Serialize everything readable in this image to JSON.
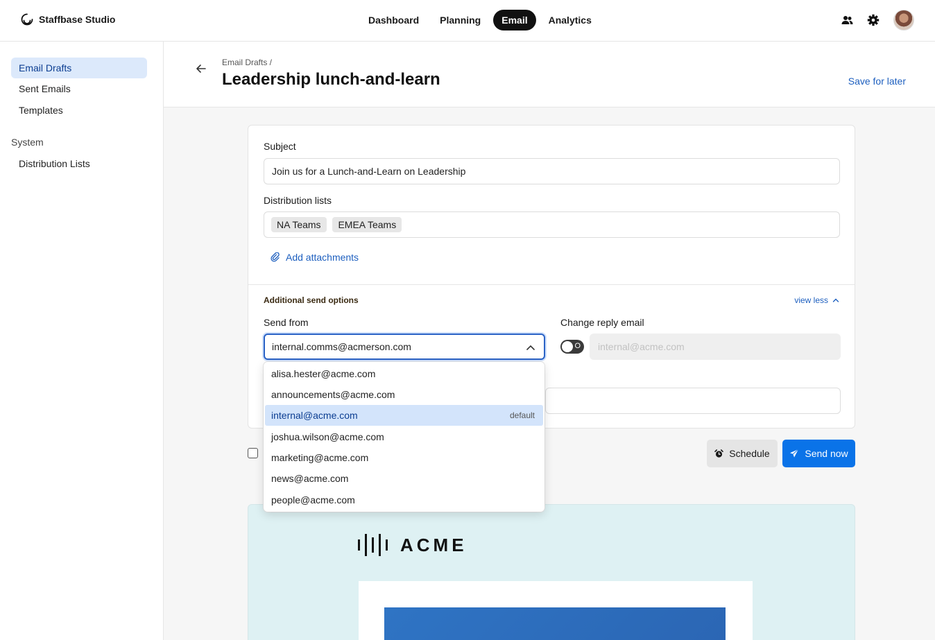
{
  "app": {
    "name": "Staffbase Studio"
  },
  "nav": {
    "items": [
      "Dashboard",
      "Planning",
      "Email",
      "Analytics"
    ],
    "active": "Email"
  },
  "sidebar": {
    "items": [
      "Email Drafts",
      "Sent Emails",
      "Templates"
    ],
    "section": "System",
    "system_items": [
      "Distribution Lists"
    ]
  },
  "header": {
    "breadcrumb": "Email Drafts  /",
    "title": "Leadership lunch-and-learn",
    "save_label": "Save for later"
  },
  "form": {
    "subject_label": "Subject",
    "subject_value": "Join us for a Lunch-and-Learn on Leadership",
    "distribution_label": "Distribution lists",
    "distribution_chips": [
      "NA Teams",
      "EMEA Teams"
    ],
    "attach_label": "Add attachments",
    "additional_title": "Additional send options",
    "view_less_label": "view less",
    "send_from_label": "Send from",
    "send_from_value": "internal.comms@acmerson.com",
    "reply_label": "Change reply email",
    "reply_toggle_state": "O",
    "reply_placeholder": "internal@acme.com"
  },
  "dropdown": {
    "options": [
      "alisa.hester@acme.com",
      "announcements@acme.com",
      "internal@acme.com",
      "joshua.wilson@acme.com",
      "marketing@acme.com",
      "news@acme.com",
      "people@acme.com"
    ],
    "selected": "internal@acme.com",
    "badge": "default"
  },
  "actions": {
    "schedule_label": "Schedule",
    "send_label": "Send now"
  },
  "preview": {
    "brand_word": "ACME"
  },
  "colors": {
    "accent": "#0a73e8",
    "link": "#1d5fbf",
    "active_nav": "#111111",
    "selection": "#d3e4fb"
  }
}
